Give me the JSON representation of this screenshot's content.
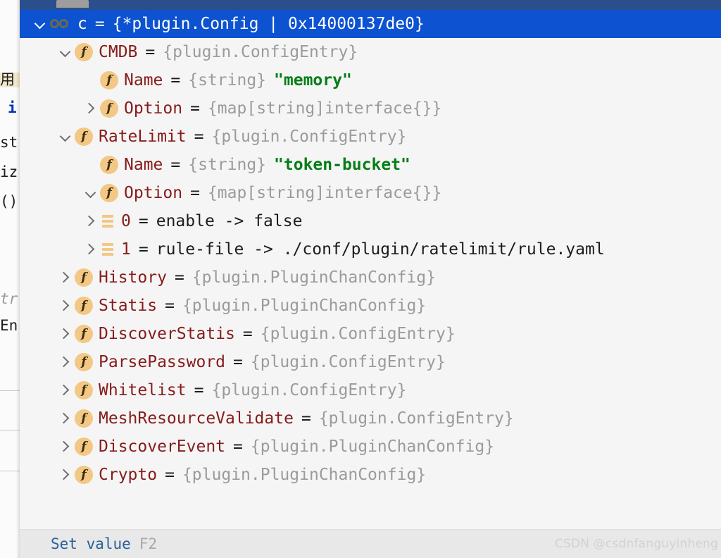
{
  "window": {
    "title_strip_color": "#2b4f8c",
    "popup_bg": "#f5f5f5",
    "selection_color": "#0d52d1"
  },
  "background_editor": {
    "fragments": [
      {
        "text": "用",
        "style": "highlight"
      },
      {
        "text": "i",
        "style": "keyword"
      },
      {
        "text": "st",
        "style": "plain"
      },
      {
        "text": "iz",
        "style": "plain"
      },
      {
        "text": "()",
        "style": "plain"
      },
      {
        "text": "tr",
        "style": "comment"
      },
      {
        "text": "En",
        "style": "plain"
      }
    ]
  },
  "tree": {
    "rows": [
      {
        "indent": 0,
        "twisty": "expanded",
        "icon": "watch-glasses-icon",
        "selected": true,
        "name": "c",
        "eq": "=",
        "type": "{*plugin.Config | 0x14000137de0}",
        "value": ""
      },
      {
        "indent": 1,
        "twisty": "expanded",
        "icon": "field-icon",
        "selected": false,
        "name": "CMDB",
        "eq": "=",
        "type": "{plugin.ConfigEntry}",
        "value": ""
      },
      {
        "indent": 2,
        "twisty": "none",
        "icon": "field-icon",
        "selected": false,
        "name": "Name",
        "eq": "=",
        "type": "{string}",
        "value": "\"memory\"",
        "value_style": "string"
      },
      {
        "indent": 2,
        "twisty": "collapsed",
        "icon": "field-icon",
        "selected": false,
        "name": "Option",
        "eq": "=",
        "type": "{map[string]interface{}}",
        "value": ""
      },
      {
        "indent": 1,
        "twisty": "expanded",
        "icon": "field-icon",
        "selected": false,
        "name": "RateLimit",
        "eq": "=",
        "type": "{plugin.ConfigEntry}",
        "value": ""
      },
      {
        "indent": 2,
        "twisty": "none",
        "icon": "field-icon",
        "selected": false,
        "name": "Name",
        "eq": "=",
        "type": "{string}",
        "value": "\"token-bucket\"",
        "value_style": "string"
      },
      {
        "indent": 2,
        "twisty": "expanded",
        "icon": "field-icon",
        "selected": false,
        "name": "Option",
        "eq": "=",
        "type": "{map[string]interface{}}",
        "value": ""
      },
      {
        "indent": 2,
        "twisty": "collapsed",
        "icon": "map-entry-icon",
        "selected": false,
        "name": "0",
        "eq": "=",
        "type": "",
        "value": "enable -> false",
        "value_style": "plain"
      },
      {
        "indent": 2,
        "twisty": "collapsed",
        "icon": "map-entry-icon",
        "selected": false,
        "name": "1",
        "eq": "=",
        "type": "",
        "value": "rule-file -> ./conf/plugin/ratelimit/rule.yaml",
        "value_style": "plain"
      },
      {
        "indent": 1,
        "twisty": "collapsed",
        "icon": "field-icon",
        "selected": false,
        "name": "History",
        "eq": "=",
        "type": "{plugin.PluginChanConfig}",
        "value": ""
      },
      {
        "indent": 1,
        "twisty": "collapsed",
        "icon": "field-icon",
        "selected": false,
        "name": "Statis",
        "eq": "=",
        "type": "{plugin.PluginChanConfig}",
        "value": ""
      },
      {
        "indent": 1,
        "twisty": "collapsed",
        "icon": "field-icon",
        "selected": false,
        "name": "DiscoverStatis",
        "eq": "=",
        "type": "{plugin.ConfigEntry}",
        "value": ""
      },
      {
        "indent": 1,
        "twisty": "collapsed",
        "icon": "field-icon",
        "selected": false,
        "name": "ParsePassword",
        "eq": "=",
        "type": "{plugin.ConfigEntry}",
        "value": ""
      },
      {
        "indent": 1,
        "twisty": "collapsed",
        "icon": "field-icon",
        "selected": false,
        "name": "Whitelist",
        "eq": "=",
        "type": "{plugin.ConfigEntry}",
        "value": ""
      },
      {
        "indent": 1,
        "twisty": "collapsed",
        "icon": "field-icon",
        "selected": false,
        "name": "MeshResourceValidate",
        "eq": "=",
        "type": "{plugin.ConfigEntry}",
        "value": ""
      },
      {
        "indent": 1,
        "twisty": "collapsed",
        "icon": "field-icon",
        "selected": false,
        "name": "DiscoverEvent",
        "eq": "=",
        "type": "{plugin.PluginChanConfig}",
        "value": ""
      },
      {
        "indent": 1,
        "twisty": "collapsed",
        "icon": "field-icon",
        "selected": false,
        "name": "Crypto",
        "eq": "=",
        "type": "{plugin.PluginChanConfig}",
        "value": ""
      }
    ]
  },
  "statusbar": {
    "action_label": "Set value",
    "shortcut_label": "F2",
    "watermark": "CSDN @csdnfanguyinheng"
  }
}
